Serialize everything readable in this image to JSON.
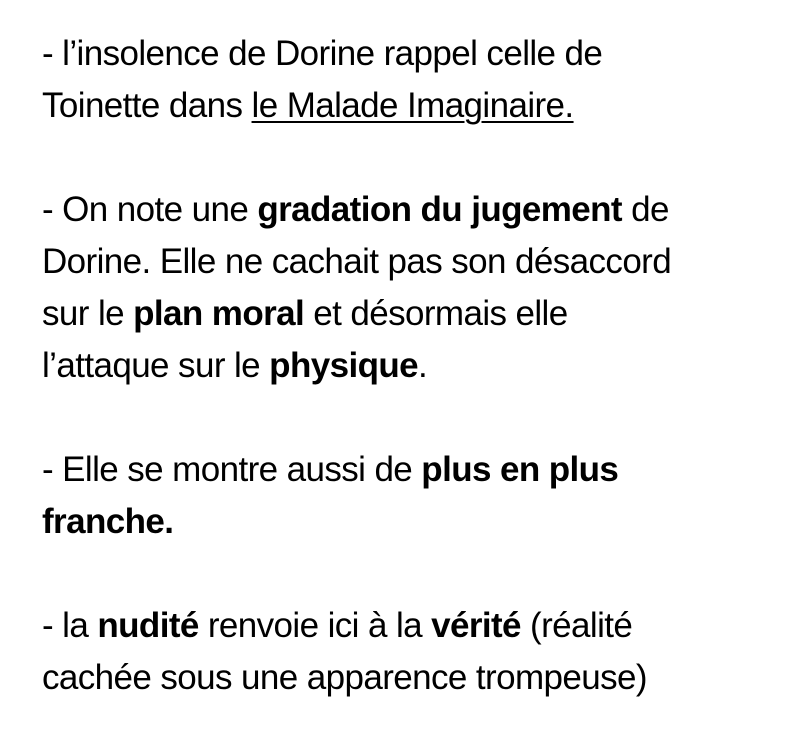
{
  "paragraphs": [
    {
      "lines": [
        "- l’insolence de Dorine rappel celle de",
        "Toinette dans "
      ],
      "underlined": "le Malade Imaginaire."
    },
    {
      "segments": [
        "- On note une ",
        "gradation du jugement",
        " de",
        "Dorine. Elle ne cachait pas son désaccord",
        "sur le ",
        "plan moral",
        " et désormais elle",
        "l’attaque sur le ",
        "physique",
        "."
      ]
    },
    {
      "segments": [
        "- Elle se montre aussi de ",
        "plus en plus",
        "franche."
      ]
    },
    {
      "segments": [
        "- la ",
        "nudité",
        " renvoie ici à la ",
        "vérité",
        " (réalité",
        "cachée sous une apparence trompeuse)"
      ]
    }
  ]
}
